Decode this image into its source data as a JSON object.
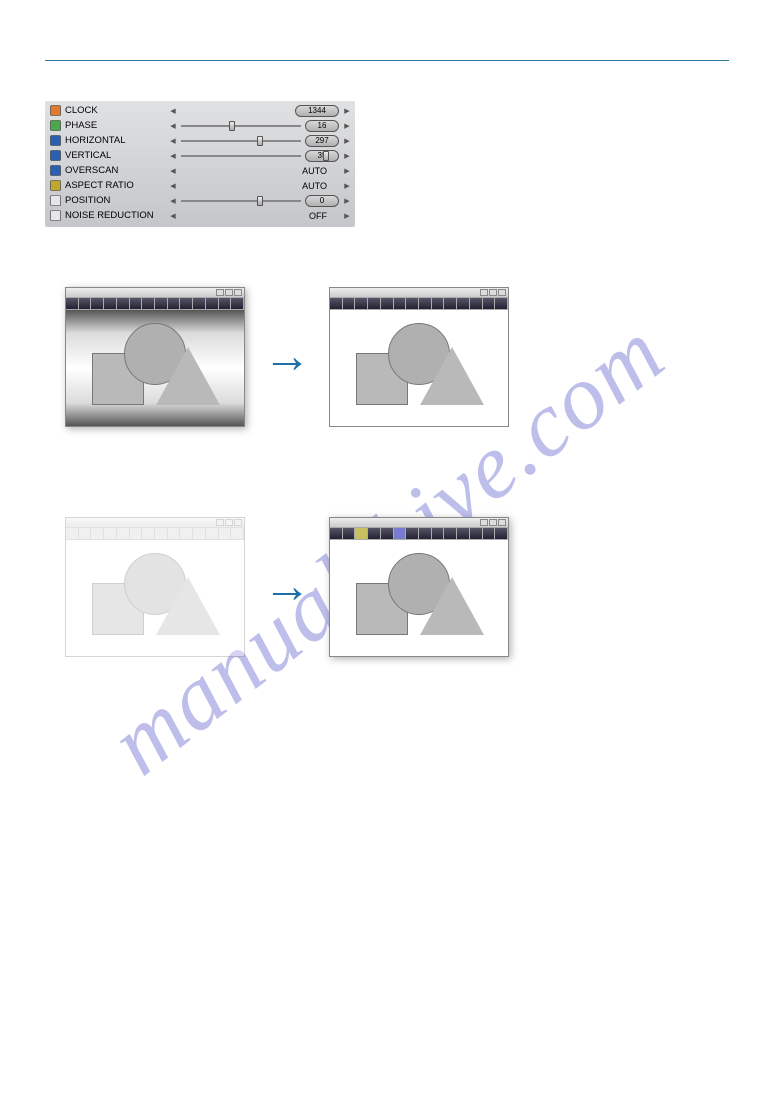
{
  "watermark": "manualshive.com",
  "osd": {
    "rows": [
      {
        "id": "clock",
        "label": "CLOCK",
        "iconColor": "#e07a2e",
        "control": "pill",
        "value": "1344"
      },
      {
        "id": "phase",
        "label": "PHASE",
        "iconColor": "#4aa84a",
        "control": "slider-pill",
        "value": "16",
        "thumb": 32
      },
      {
        "id": "horizontal",
        "label": "HORIZONTAL",
        "iconColor": "#2b5fb0",
        "control": "slider-pill",
        "value": "297",
        "thumb": 50
      },
      {
        "id": "vertical",
        "label": "VERTICAL",
        "iconColor": "#2b5fb0",
        "control": "slider-pill",
        "value": "35",
        "thumb": 92
      },
      {
        "id": "overscan",
        "label": "OVERSCAN",
        "iconColor": "#2b5fb0",
        "control": "option",
        "value": "AUTO"
      },
      {
        "id": "aspect-ratio",
        "label": "ASPECT RATIO",
        "iconColor": "#c0a830",
        "control": "option",
        "value": "AUTO"
      },
      {
        "id": "position",
        "label": "POSITION",
        "iconColor": "#e6e6e6",
        "control": "slider-pill",
        "value": "0",
        "thumb": 50
      },
      {
        "id": "noise-reduction",
        "label": "NOISE REDUCTION",
        "iconColor": "#e6e6e6",
        "control": "option",
        "value": "OFF"
      }
    ]
  }
}
